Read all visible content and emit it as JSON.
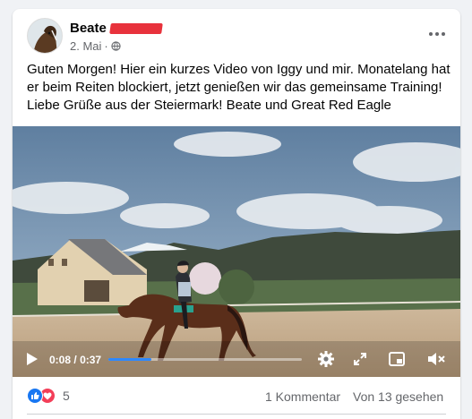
{
  "post": {
    "author_first_name": "Beate",
    "date": "2. Mai",
    "text": "Guten Morgen! Hier ein kurzes Video von Iggy und mir. Monatelang hat er beim Reiten blockiert, jetzt genießen wir das gemeinsame Training! Liebe Grüße aus der Steiermark! Beate und Great Red Eagle"
  },
  "video": {
    "current_time": "0:08",
    "duration": "0:37",
    "progress_fraction": 0.22
  },
  "footer": {
    "reaction_count": "5",
    "comments_label": "1 Kommentar",
    "views_label": "Von 13 gesehen"
  },
  "colors": {
    "accent": "#1877f2",
    "love": "#f33e58",
    "redaction": "#e8323c"
  },
  "icons": {
    "privacy": "globe-icon",
    "menu": "more-horizontal-icon",
    "play": "play-icon",
    "settings": "gear-icon",
    "fullscreen": "fullscreen-icon",
    "pip": "picture-in-picture-icon",
    "volume": "volume-muted-icon"
  }
}
